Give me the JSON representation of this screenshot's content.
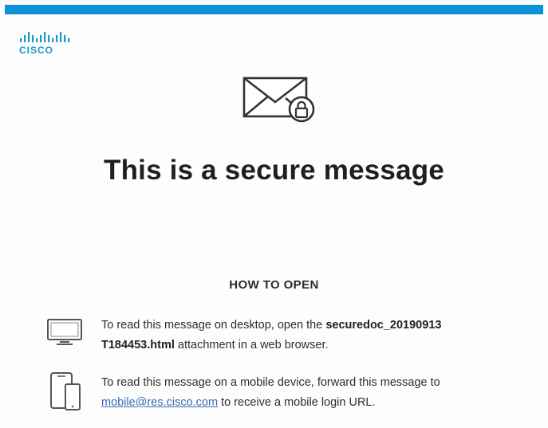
{
  "brand": {
    "logo_text": "CISCO",
    "accent_color": "#0b93d6"
  },
  "title": "This is a secure message",
  "how_to_open": {
    "heading": "HOW TO OPEN",
    "desktop": {
      "icon": "desktop-monitor-icon",
      "text_before": "To read this message on desktop, open the ",
      "filename_line1": "securedoc_20190913",
      "filename_line2": "T184453.html",
      "text_after": " attachment in a web browser."
    },
    "mobile": {
      "icon": "mobile-devices-icon",
      "text_before": "To read this message on a mobile device, forward this message to",
      "email_link": "mobile@res.cisco.com",
      "text_after": " to receive a mobile login URL."
    }
  },
  "icons": {
    "envelope": "envelope-lock-icon"
  }
}
